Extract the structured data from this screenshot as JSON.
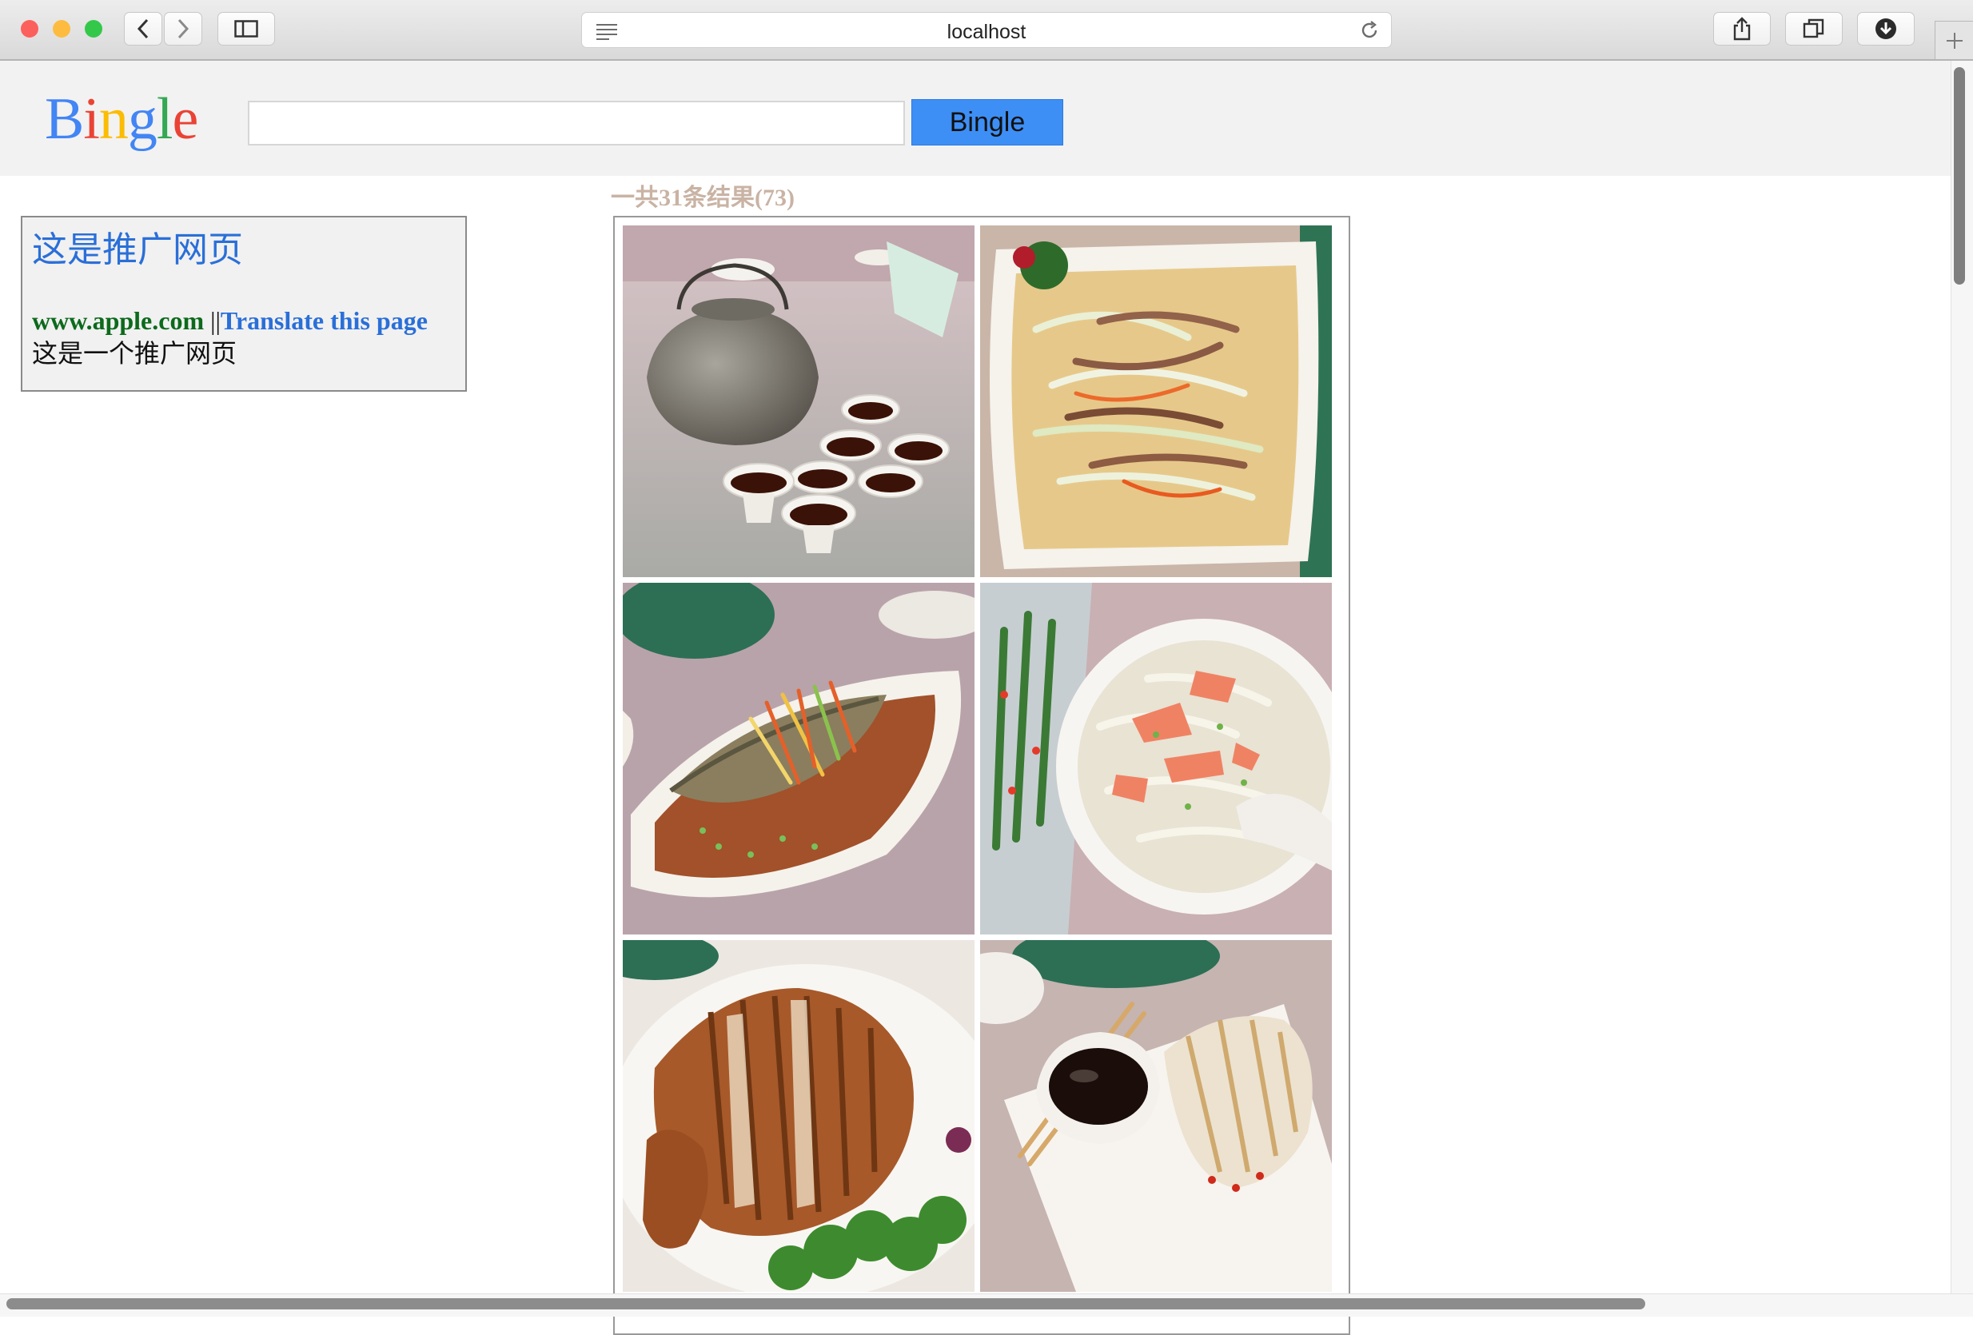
{
  "browser": {
    "address": "localhost",
    "traffic_light_colors": [
      "#fc605c",
      "#fdbc40",
      "#34c84a"
    ],
    "icons": [
      "back-icon",
      "forward-icon",
      "sidebar-icon",
      "reader-icon",
      "reload-icon",
      "share-icon",
      "tabs-icon",
      "download-icon",
      "new-tab-icon"
    ]
  },
  "header": {
    "logo": "Bingle",
    "logo_colors": [
      "#4285f4",
      "#ea4335",
      "#fbbc05",
      "#4285f4",
      "#34a853",
      "#ea4335"
    ],
    "search_value": "",
    "search_button": "Bingle",
    "search_button_color": "#3d8ff5"
  },
  "results": {
    "count_text": "一共31条结果(73)"
  },
  "ad": {
    "title": "这是推广网页",
    "url": "www.apple.com",
    "separator": "||",
    "translate": "Translate this page",
    "description": "这是一个推广网页"
  },
  "images": [
    {
      "subject": "tea pot with cups of tea"
    },
    {
      "subject": "stir-fried cabbage with shredded pork"
    },
    {
      "subject": "steamed fish with shredded ginger"
    },
    {
      "subject": "cabbage soup with sliced ham"
    },
    {
      "subject": "roast duck with parsley"
    },
    {
      "subject": "sliced chicken with dipping sauce"
    }
  ]
}
